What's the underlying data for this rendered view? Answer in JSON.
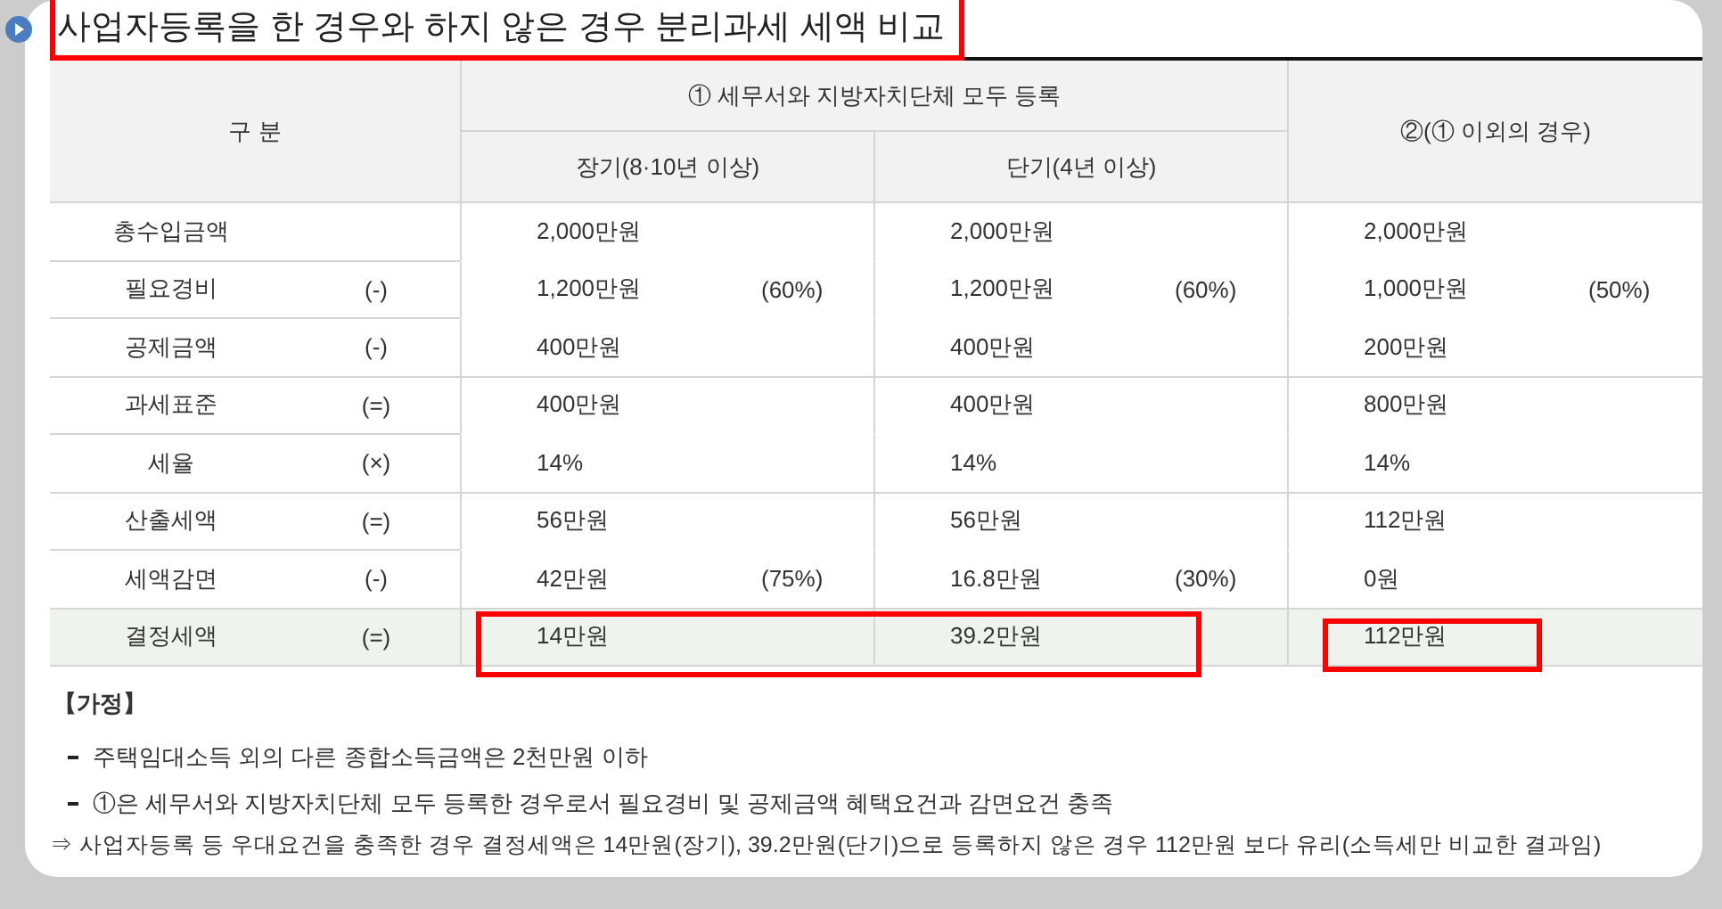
{
  "title": {
    "text": "사업자등록을 한 경우와 하지 않은 경우 분리과세 세액 비교",
    "boxed": true
  },
  "table": {
    "header": {
      "category": "구 분",
      "group": "① 세무서와 지방자치단체 모두 등록",
      "sub": [
        "장기(8·10년 이상)",
        "단기(4년 이상)"
      ],
      "other": "②(① 이외의 경우)"
    },
    "groups": [
      {
        "shaded": false,
        "rows": [
          {
            "label": "총수입금액",
            "cells": [
              {
                "value": "2,000만원"
              },
              {
                "value": "2,000만원"
              },
              {
                "value": "2,000만원"
              }
            ]
          },
          {
            "label": "필요경비",
            "op": "(-)",
            "cells": [
              {
                "value": "1,200만원",
                "pct": "(60%)"
              },
              {
                "value": "1,200만원",
                "pct": "(60%)"
              },
              {
                "value": "1,000만원",
                "pct": "(50%)"
              }
            ]
          },
          {
            "label": "공제금액",
            "op": "(-)",
            "cells": [
              {
                "value": "400만원"
              },
              {
                "value": "400만원"
              },
              {
                "value": "200만원"
              }
            ]
          }
        ]
      },
      {
        "shaded": false,
        "rows": [
          {
            "label": "과세표준",
            "op": "(=)",
            "cells": [
              {
                "value": "400만원"
              },
              {
                "value": "400만원"
              },
              {
                "value": "800만원"
              }
            ]
          },
          {
            "label": "세율",
            "op": "(×)",
            "cells": [
              {
                "value": "14%"
              },
              {
                "value": "14%"
              },
              {
                "value": "14%"
              }
            ]
          }
        ]
      },
      {
        "shaded": false,
        "rows": [
          {
            "label": "산출세액",
            "op": "(=)",
            "cells": [
              {
                "value": "56만원"
              },
              {
                "value": "56만원"
              },
              {
                "value": "112만원"
              }
            ]
          },
          {
            "label": "세액감면",
            "op": "(-)",
            "cells": [
              {
                "value": "42만원",
                "pct": "(75%)"
              },
              {
                "value": "16.8만원",
                "pct": "(30%)"
              },
              {
                "value": "0원"
              }
            ]
          }
        ]
      },
      {
        "shaded": true,
        "rows": [
          {
            "label": "결정세액",
            "op": "(=)",
            "cells": [
              {
                "value": "14만원",
                "boxed": true
              },
              {
                "value": "39.2만원",
                "boxed": true
              },
              {
                "value": "112만원",
                "boxed": true,
                "boxed_apart": true
              }
            ]
          }
        ]
      }
    ]
  },
  "notes": {
    "heading": "【가정】",
    "items": [
      "주택임대소득 외의 다른 종합소득금액은 2천만원 이하",
      "①은 세무서와 지방자치단체 모두 등록한 경우로서 필요경비 및 공제금액 혜택요건과 감면요건 충족"
    ],
    "conclusion": "⇒ 사업자등록 등 우대요건을 충족한 경우 결정세액은 14만원(장기), 39.2만원(단기)으로 등록하지 않은 경우 112만원 보다 유리(소득세만 비교한 결과임)"
  }
}
